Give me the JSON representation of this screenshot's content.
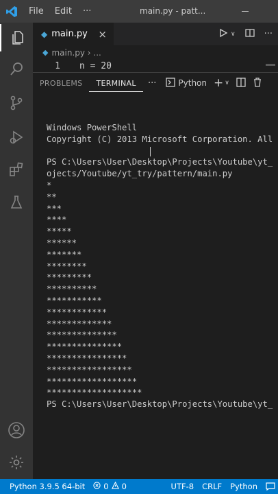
{
  "titlebar": {
    "menu": [
      "File",
      "Edit"
    ],
    "more": "···",
    "title": "main.py - patt..."
  },
  "activity_bar": {
    "items": [
      "explorer-icon",
      "search-icon",
      "source-control-icon",
      "run-debug-icon",
      "extensions-icon",
      "testing-icon"
    ],
    "bottom": [
      "accounts-icon",
      "manage-gear-icon"
    ]
  },
  "editor": {
    "tab_label": "main.py",
    "tab_close": "×",
    "breadcrumb": "main.py › ...",
    "line_number": "1",
    "line_code": "n = 20"
  },
  "panel": {
    "tabs": [
      "PROBLEMS",
      "TERMINAL"
    ],
    "more": "···",
    "terminal_profile": "Python",
    "add": "+",
    "dropdown": "∨"
  },
  "terminal": {
    "lines": [
      "Windows PowerShell",
      "Copyright (C) 2013 Microsoft Corporation. All",
      "",
      "PS C:\\Users\\User\\Desktop\\Projects\\Youtube\\yt_",
      "ojects/Youtube/yt_try/pattern/main.py",
      "*",
      "**",
      "***",
      "****",
      "*****",
      "******",
      "*******",
      "********",
      "*********",
      "**********",
      "***********",
      "************",
      "*************",
      "**************",
      "***************",
      "****************",
      "*****************",
      "******************",
      "*******************",
      "PS C:\\Users\\User\\Desktop\\Projects\\Youtube\\yt_"
    ]
  },
  "statusbar": {
    "interpreter": "Python 3.9.5 64-bit",
    "errors": "0",
    "warnings": "0",
    "encoding": "UTF-8",
    "eol": "CRLF",
    "language": "Python"
  },
  "colors": {
    "accent": "#007acc",
    "titlebar": "#3c3c3c",
    "activity_bar": "#333333",
    "editor_bg": "#1e1e1e"
  }
}
